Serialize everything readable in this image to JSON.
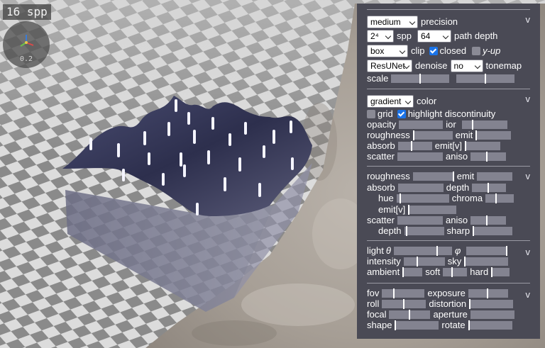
{
  "viewport": {
    "spp_readout": "16 spp",
    "gizmo_scale": "0.2"
  },
  "panel": {
    "toggle_glyph": "v",
    "render": {
      "precision_value": "medium",
      "precision_label": "precision",
      "spp_value": "2⁴",
      "spp_label": "spp",
      "path_depth_value": "64",
      "path_depth_label": "path depth",
      "clip_value": "box",
      "clip_label": "clip",
      "closed_label": "closed",
      "closed_checked": true,
      "yup_label": "y-up",
      "yup_checked": false,
      "denoise_value": "ResUNet",
      "denoise_label": "denoise",
      "tonemap_value": "no",
      "tonemap_label": "tonemap",
      "scale_label": "scale",
      "scale_level_a": 0.5,
      "scale_level_b": 0.5
    },
    "color": {
      "mode_value": "gradient",
      "mode_label": "color",
      "grid_label": "grid",
      "grid_checked": false,
      "highlight_label": "highlight discontinuity",
      "highlight_checked": true,
      "opacity_label": "opacity",
      "ior_label": "ior",
      "roughness_label": "roughness",
      "emit_label": "emit",
      "absorb_label": "absorb",
      "emitv_label": "emit[v]",
      "scatter_label": "scatter",
      "aniso_label": "aniso"
    },
    "material": {
      "roughness_label": "roughness",
      "emit_label": "emit",
      "absorb_label": "absorb",
      "depth_label": "depth",
      "hue_label": "hue",
      "chroma_label": "chroma",
      "emitv_label": "emit[v]",
      "scatter_label": "scatter",
      "aniso_label": "aniso",
      "depth2_label": "depth",
      "sharp_label": "sharp"
    },
    "light": {
      "light_label": "light",
      "theta_symbol": "θ",
      "phi_symbol": "φ",
      "intensity_label": "intensity",
      "sky_label": "sky",
      "ambient_label": "ambient",
      "soft_label": "soft",
      "hard_label": "hard"
    },
    "camera": {
      "fov_label": "fov",
      "exposure_label": "exposure",
      "roll_label": "roll",
      "distortion_label": "distortion",
      "focal_label": "focal",
      "aperture_label": "aperture",
      "shape_label": "shape",
      "rotate_label": "rotate"
    }
  }
}
